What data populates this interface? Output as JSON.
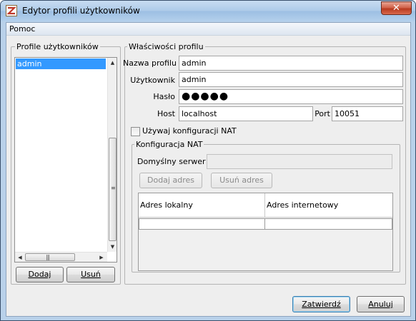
{
  "window": {
    "title": "Edytor profili użytkowników",
    "close_symbol": "✕"
  },
  "menu": {
    "items": [
      {
        "label": "Pomoc"
      }
    ]
  },
  "profiles_panel": {
    "legend": "Profile użytkowników",
    "items": [
      "admin"
    ],
    "add_button": "Dodaj",
    "remove_button": "Usuń"
  },
  "properties": {
    "legend": "Właściwości profilu",
    "profile_name_label": "Nazwa profilu",
    "profile_name_value": "admin",
    "user_label": "Użytkownik",
    "user_value": "admin",
    "password_label": "Hasło",
    "password_value": "●●●●●",
    "host_label": "Host",
    "host_value": "localhost",
    "port_label": "Port",
    "port_value": "10051",
    "use_nat_label": "Używaj konfiguracji NAT",
    "use_nat_checked": false
  },
  "nat": {
    "legend": "Konfiguracja NAT",
    "default_server_label": "Domyślny serwer",
    "default_server_value": "",
    "add_address_button": "Dodaj adres",
    "remove_address_button": "Usuń adres",
    "columns": [
      "Adres lokalny",
      "Adres internetowy"
    ]
  },
  "footer": {
    "confirm_button": "Zatwierdź",
    "cancel_button": "Anuluj"
  }
}
